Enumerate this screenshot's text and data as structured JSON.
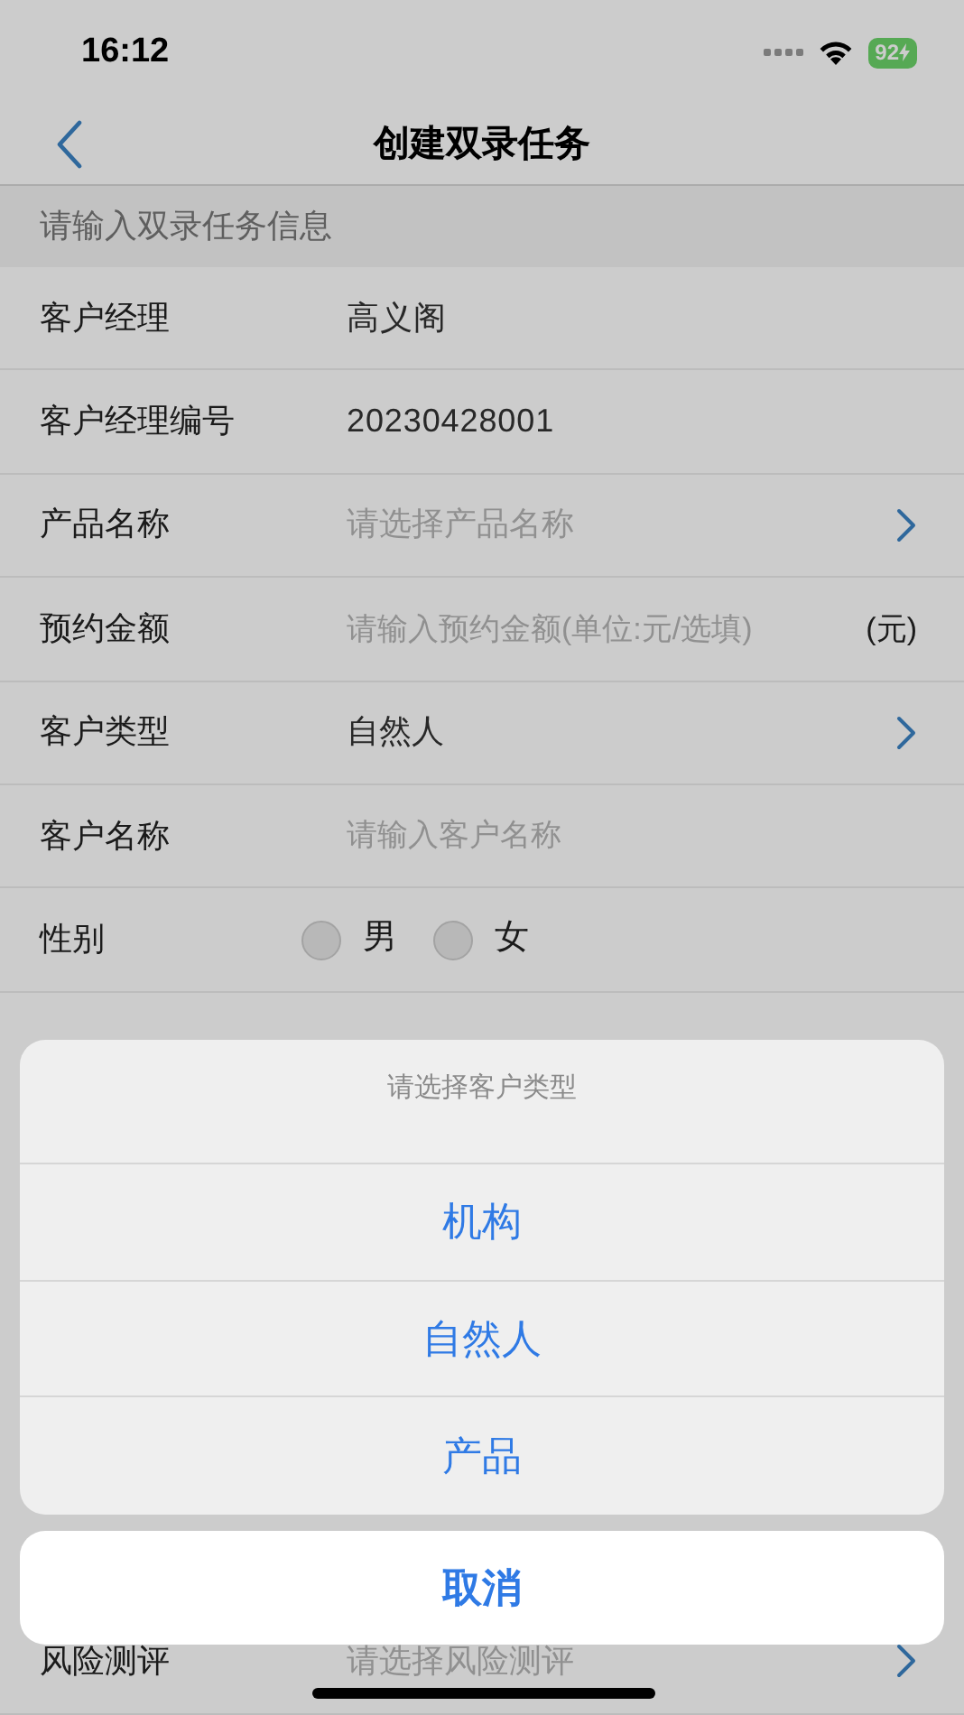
{
  "status_bar": {
    "time": "16:12",
    "battery": "92"
  },
  "nav": {
    "title": "创建双录任务"
  },
  "section_header": "请输入双录任务信息",
  "fields": [
    {
      "kind": "text",
      "label": "客户经理",
      "value": "高义阁"
    },
    {
      "kind": "text",
      "label": "客户经理编号",
      "value": "20230428001"
    },
    {
      "kind": "select",
      "label": "产品名称",
      "placeholder": "请选择产品名称"
    },
    {
      "kind": "input",
      "label": "预约金额",
      "placeholder": "请输入预约金额(单位:元/选填)",
      "suffix": "(元)"
    },
    {
      "kind": "select",
      "label": "客户类型",
      "value": "自然人"
    },
    {
      "kind": "input",
      "label": "客户名称",
      "placeholder": "请输入客户名称"
    },
    {
      "kind": "radio",
      "label": "性别",
      "options": [
        {
          "label": "男",
          "selected": false
        },
        {
          "label": "女",
          "selected": false
        }
      ]
    }
  ],
  "last_field": {
    "kind": "select",
    "label": "风险测评",
    "placeholder": "请选择风险测评"
  },
  "action_sheet": {
    "title": "请选择客户类型",
    "options": [
      "机构",
      "自然人",
      "产品"
    ],
    "cancel": "取消"
  }
}
